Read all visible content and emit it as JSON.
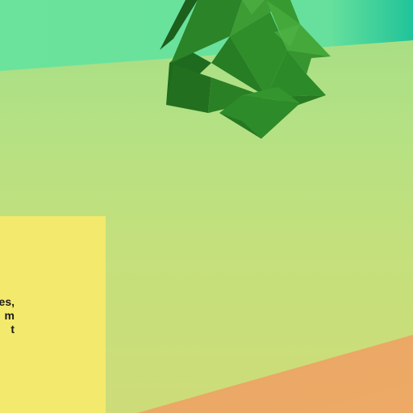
{
  "scene": {
    "description_colors": {
      "sky_band_top": "#6ce39c",
      "sky_band_right": "#22c49a",
      "meadow_top": "#a4dd86",
      "meadow_bottom": "#cddc78",
      "orange_wedge": "#eba866",
      "yellow_card": "#f3e96c",
      "tree_dark": "#1f6b1f",
      "tree_mid": "#2e8a2a",
      "tree_light": "#43a83a"
    }
  },
  "card": {
    "lines": [
      "es,",
      "m",
      "t"
    ]
  }
}
